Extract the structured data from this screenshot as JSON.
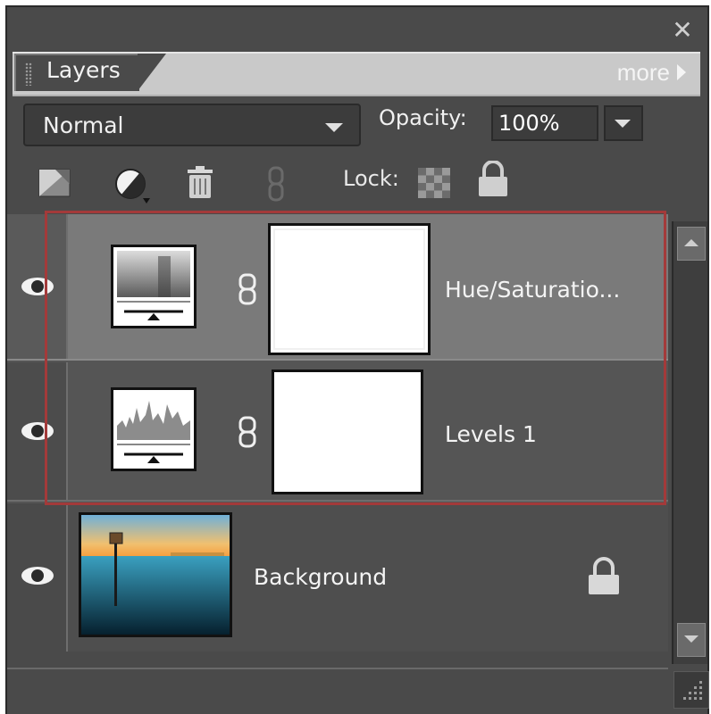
{
  "panel": {
    "tab_label": "Layers",
    "more_label": "more",
    "close_glyph": "✕"
  },
  "controls": {
    "blend_mode": "Normal",
    "opacity_label": "Opacity:",
    "opacity_value": "100%",
    "lock_label": "Lock:"
  },
  "toolbar": {
    "icons": [
      "new-layer-icon",
      "adjustment-layer-icon",
      "trash-icon",
      "link-icon",
      "lock-transparency-icon",
      "lock-all-icon"
    ]
  },
  "layers": [
    {
      "name": "Hue/Saturatio...",
      "type": "adjustment-hue-saturation",
      "visible": true,
      "selected": true
    },
    {
      "name": "Levels 1",
      "type": "adjustment-levels",
      "visible": true,
      "selected": false
    },
    {
      "name": "Background",
      "type": "image",
      "visible": true,
      "locked": true
    }
  ],
  "colors": {
    "panel_bg": "#4a4a4a",
    "selected_row": "#7a7a7a",
    "row_bg": "#555555",
    "highlight_border": "#a33a3a"
  }
}
